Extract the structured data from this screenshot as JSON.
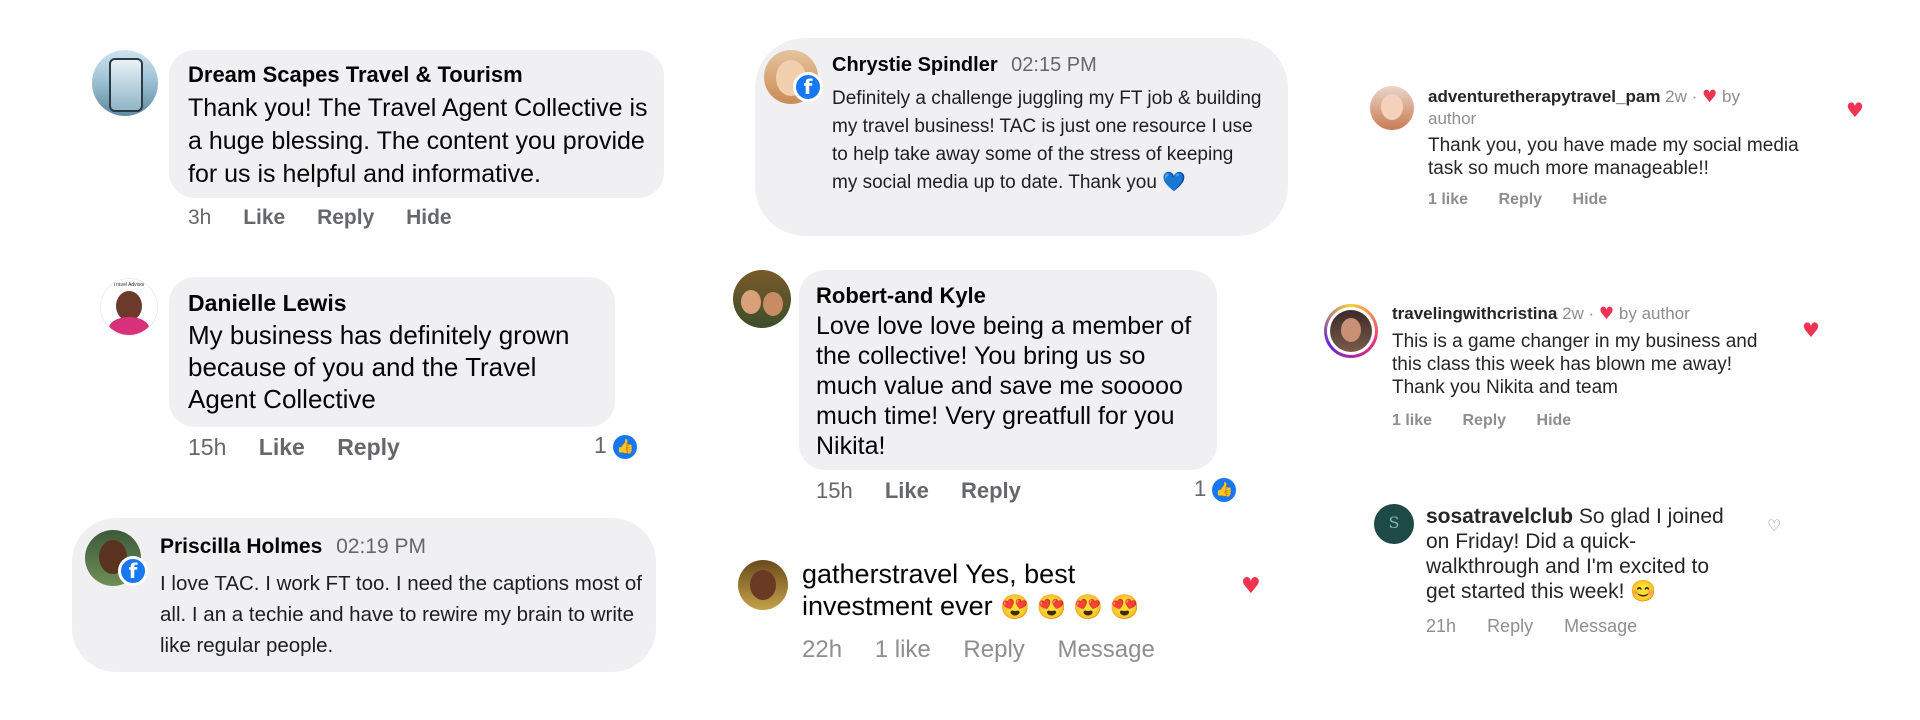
{
  "comments": {
    "c1": {
      "author": "Dream Scapes Travel & Tourism",
      "text": "Thank you! The Travel Agent Collective is a huge blessing. The content you provide for us is helpful and informative.",
      "time": "3h",
      "like": "Like",
      "reply": "Reply",
      "hide": "Hide"
    },
    "c2": {
      "author": "Danielle Lewis",
      "avatar_caption": "Travel Advisor",
      "text": "My business has definitely grown because of you and the Travel Agent Collective",
      "time": "15h",
      "like": "Like",
      "reply": "Reply",
      "reaction_count": "1"
    },
    "c3": {
      "author": "Priscilla Holmes",
      "time": "02:19 PM",
      "text": "I love TAC. I work FT too. I need the captions most of all. I an a techie and have to rewire my brain to write like regular people."
    },
    "c4": {
      "author": "Chrystie Spindler",
      "time": "02:15 PM",
      "text": "Definitely a challenge juggling my FT job & building my travel business! TAC is just one resource I use to help take away some of the stress of keeping my social media up to date. Thank you",
      "emoji": "💙"
    },
    "c5": {
      "author": "Robert-and Kyle",
      "text": "Love love love being a member of the collective! You bring us so much value and save me sooooo much time! Very greatfull for you Nikita!",
      "time": "15h",
      "like": "Like",
      "reply": "Reply",
      "reaction_count": "1"
    },
    "c6": {
      "author": "gatherstravel",
      "text": "Yes, best investment ever",
      "emoji": "😍 😍 😍 😍",
      "time": "22h",
      "likes": "1 like",
      "reply": "Reply",
      "message": "Message"
    },
    "c7": {
      "author": "adventuretherapytravel_pam",
      "meta_time": "2w ·",
      "meta_by": "by author",
      "text": "Thank you, you have made my social media task so much more manageable!!",
      "likes": "1 like",
      "reply": "Reply",
      "hide": "Hide"
    },
    "c8": {
      "author": "travelingwithcristina",
      "meta_time": "2w ·",
      "meta_by": "by author",
      "text": "This is a game changer in my business and this class this week has blown me away! Thank you Nikita and team",
      "likes": "1 like",
      "reply": "Reply",
      "hide": "Hide"
    },
    "c9": {
      "author": "sosatravelclub",
      "text": "So glad I joined on Friday! Did a quick-walkthrough and I'm excited to get started this week!",
      "emoji": "😊",
      "time": "21h",
      "reply": "Reply",
      "message": "Message"
    }
  },
  "icons": {
    "facebook": "facebook-f-icon",
    "like": "thumbs-up-icon",
    "heart": "heart-icon"
  },
  "colors": {
    "bubble": "#f0f0f2",
    "facebook_blue": "#1877f2",
    "heart": "#ee3353",
    "muted": "#65676b"
  }
}
